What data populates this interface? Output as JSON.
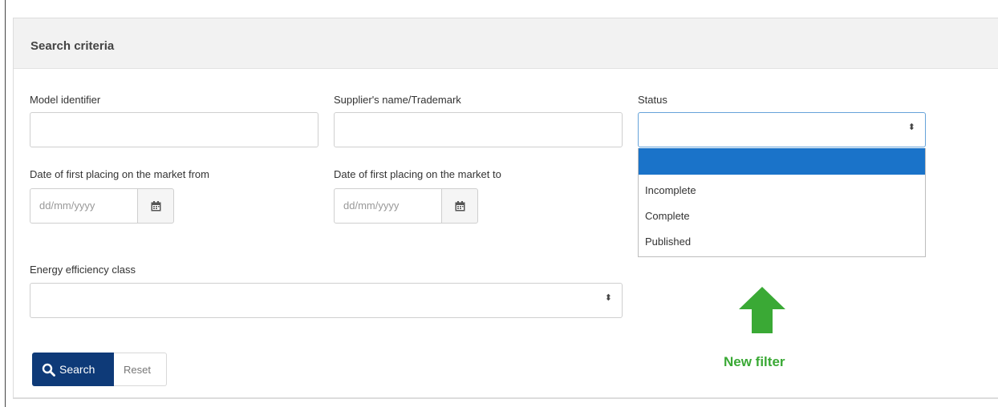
{
  "panel": {
    "title": "Search criteria"
  },
  "fields": {
    "model_identifier": {
      "label": "Model identifier",
      "value": ""
    },
    "supplier": {
      "label": "Supplier's name/Trademark",
      "value": ""
    },
    "status": {
      "label": "Status",
      "value": "",
      "options": [
        "",
        "Incomplete",
        "Complete",
        "Published"
      ]
    },
    "date_from": {
      "label": "Date of first placing on the market from",
      "placeholder": "dd/mm/yyyy"
    },
    "date_to": {
      "label": "Date of first placing on the market to",
      "placeholder": "dd/mm/yyyy"
    },
    "energy_class": {
      "label": "Energy efficiency class",
      "value": ""
    }
  },
  "buttons": {
    "search": "Search",
    "reset": "Reset"
  },
  "annotation": {
    "text": "New filter",
    "color": "#3aa935"
  },
  "colors": {
    "primary": "#0e3a78",
    "dropdown_highlight": "#1a73c9"
  }
}
